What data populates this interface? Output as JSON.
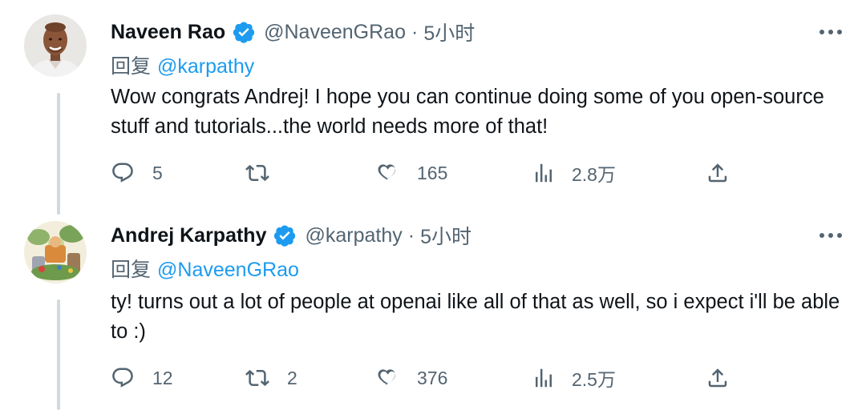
{
  "tweets": [
    {
      "name": "Naveen Rao",
      "handle": "@NaveenGRao",
      "dot": "·",
      "time": "5小时",
      "reply_prefix": "回复",
      "reply_mention": "@karpathy",
      "text": "Wow congrats Andrej! I hope you can continue doing some of you open-source stuff and tutorials...the world needs more of that!",
      "replies": "5",
      "retweets": "",
      "likes": "165",
      "views": "2.8万"
    },
    {
      "name": "Andrej Karpathy",
      "handle": "@karpathy",
      "dot": "·",
      "time": "5小时",
      "reply_prefix": "回复",
      "reply_mention": "@NaveenGRao",
      "text": "ty! turns out a lot of people at openai like all of that as well, so i expect i'll be able to :)",
      "replies": "12",
      "retweets": "2",
      "likes": "376",
      "views": "2.5万"
    }
  ],
  "icons": {
    "verified": "verified-badge-icon",
    "more": "more-icon",
    "reply": "reply-icon",
    "retweet": "retweet-icon",
    "like": "heart-icon",
    "views": "views-icon",
    "share": "share-icon"
  },
  "colors": {
    "accent": "#1d9bf0",
    "secondary_text": "#536471",
    "thread_line": "#cfd9de"
  }
}
